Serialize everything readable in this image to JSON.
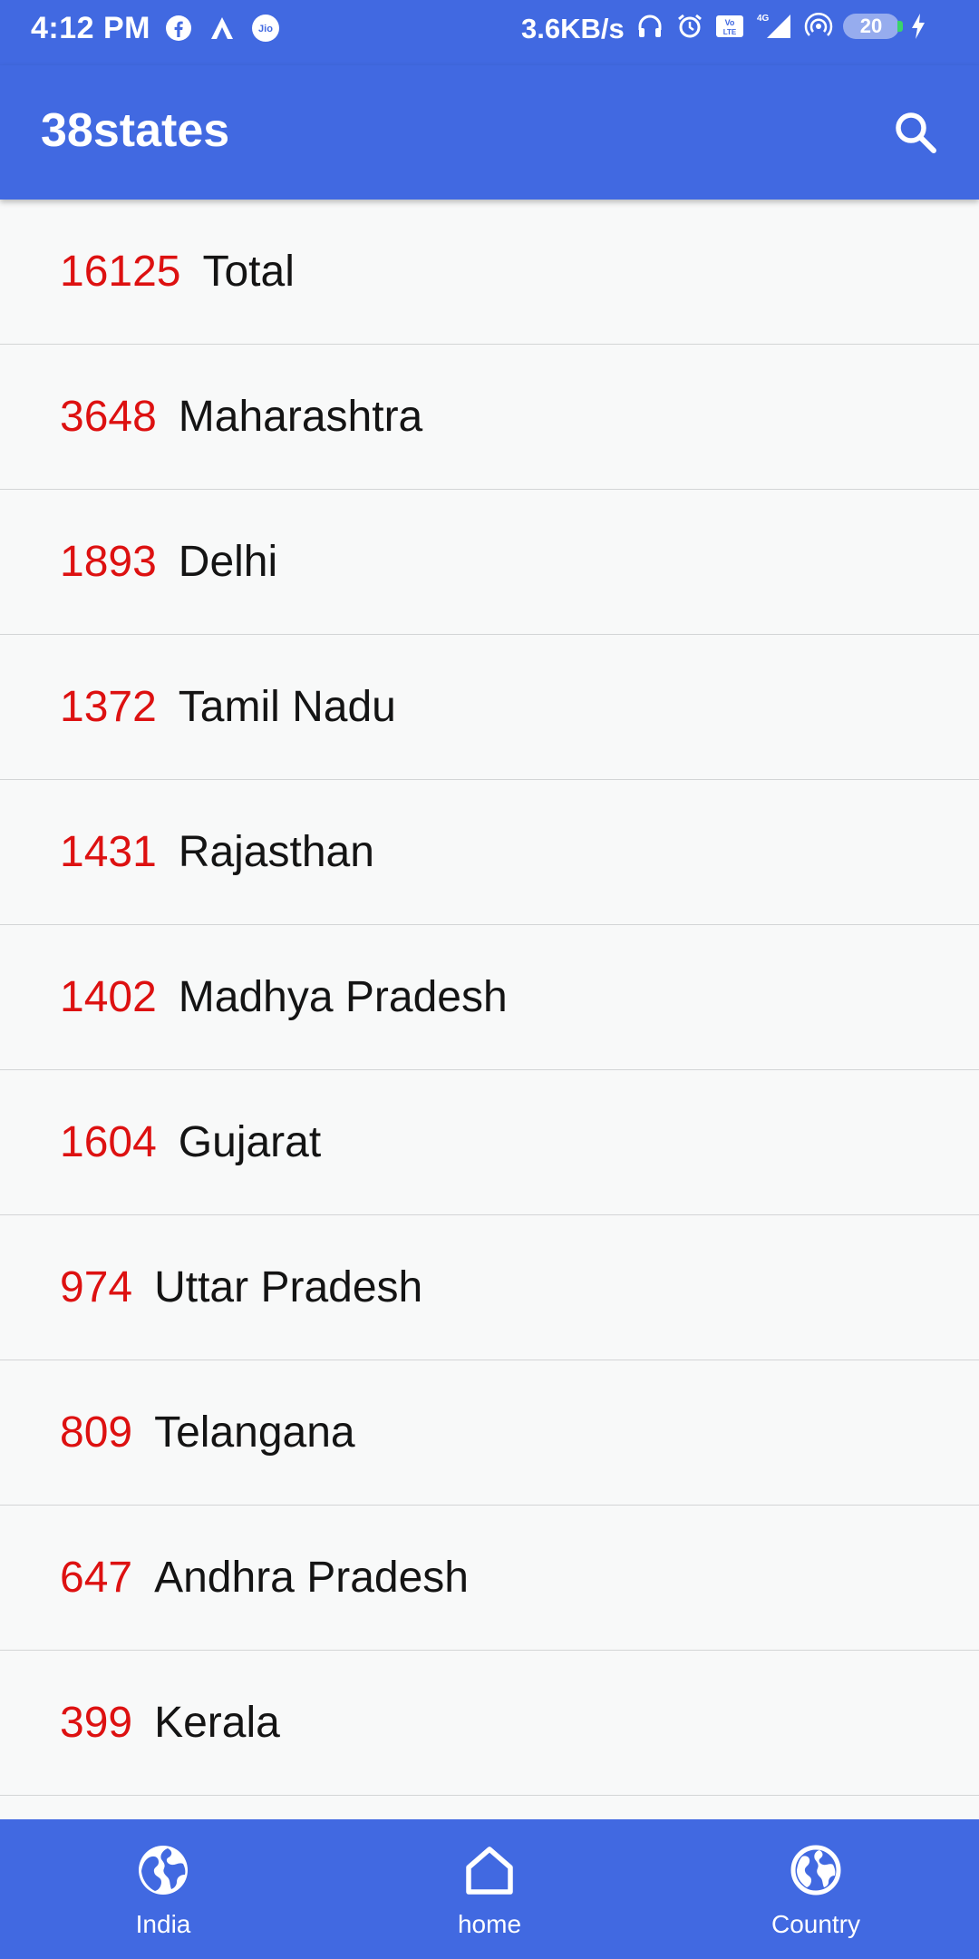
{
  "status_bar": {
    "time": "4:12 PM",
    "network_speed": "3.6KB/s",
    "network_type": "4G",
    "volte": "Vo LTE",
    "carrier_icon_text": "Jio",
    "battery": "20",
    "icons": [
      "facebook-icon",
      "a-app-icon",
      "jio-icon",
      "headphones-icon",
      "alarm-icon",
      "volte-icon",
      "signal-icon",
      "hotspot-icon",
      "battery-icon",
      "charging-icon"
    ]
  },
  "app_bar": {
    "title": "38states",
    "search_icon": "search-icon"
  },
  "states": [
    {
      "count": "16125",
      "name": "Total"
    },
    {
      "count": "3648",
      "name": "Maharashtra"
    },
    {
      "count": "1893",
      "name": "Delhi"
    },
    {
      "count": "1372",
      "name": "Tamil Nadu"
    },
    {
      "count": "1431",
      "name": "Rajasthan"
    },
    {
      "count": "1402",
      "name": "Madhya Pradesh"
    },
    {
      "count": "1604",
      "name": "Gujarat"
    },
    {
      "count": "974",
      "name": "Uttar Pradesh"
    },
    {
      "count": "809",
      "name": "Telangana"
    },
    {
      "count": "647",
      "name": "Andhra Pradesh"
    },
    {
      "count": "399",
      "name": "Kerala"
    },
    {
      "count": "",
      "name": ""
    }
  ],
  "bottom_nav": {
    "items": [
      {
        "label": "India",
        "icon": "globe-icon"
      },
      {
        "label": "home",
        "icon": "home-icon"
      },
      {
        "label": "Country",
        "icon": "globe-icon"
      }
    ]
  },
  "colors": {
    "primary": "#4169e1",
    "count_red": "#dd1111",
    "text_dark": "#141414",
    "background": "#f8f9f9",
    "divider": "#d3d5d6"
  }
}
